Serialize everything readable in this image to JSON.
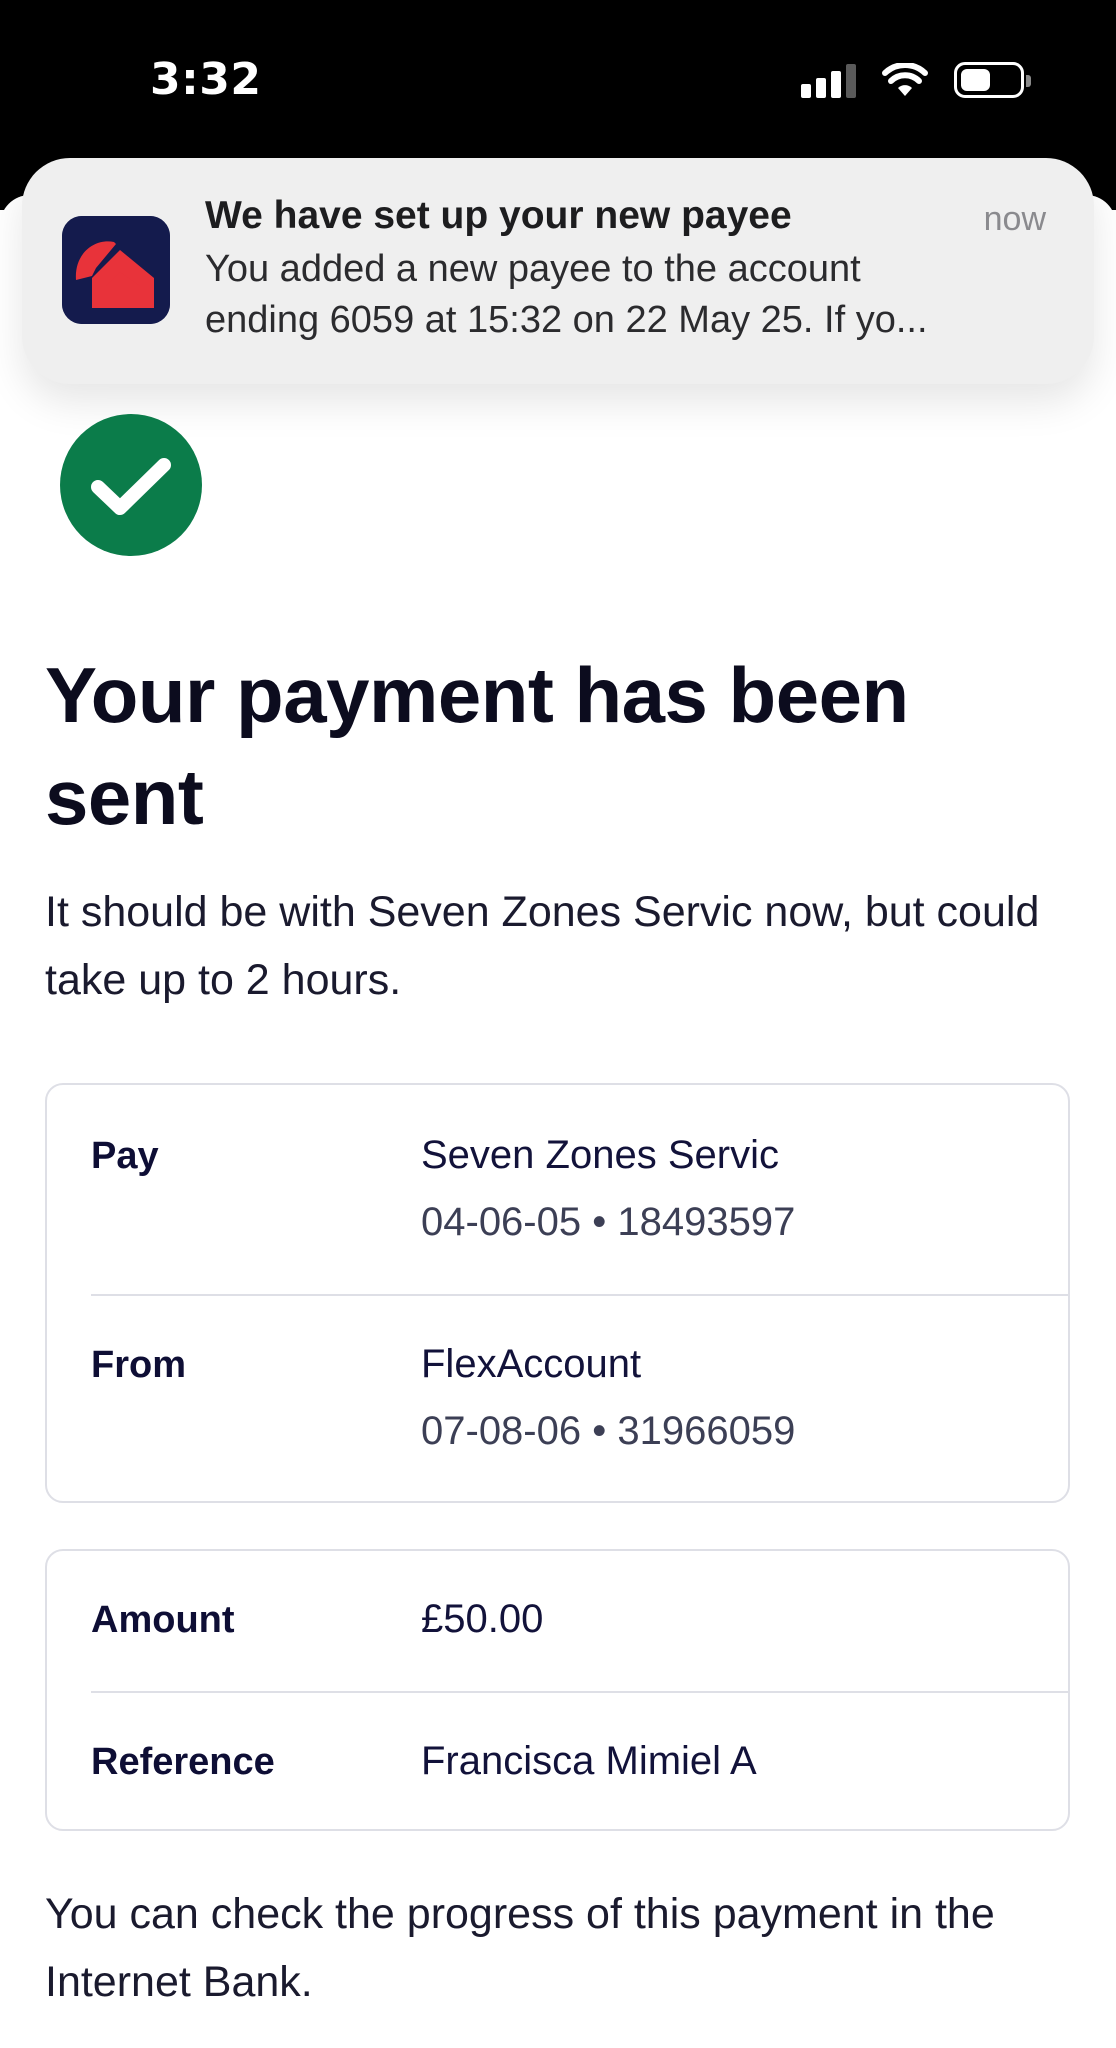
{
  "status_bar": {
    "time": "3:32",
    "signal_bars": 3,
    "signal_bars_total": 4,
    "battery_level": 0.45
  },
  "notification": {
    "title": "We have set up your new payee",
    "time": "now",
    "body_line_1": "You added a new payee to the account",
    "body_line_2": "ending 6059 at 15:32 on 22 May 25. If yo...",
    "icon": "bank-app-icon",
    "icon_colors": {
      "background": "#141b4d",
      "accent": "#e8333a"
    }
  },
  "success": {
    "icon": "checkmark-icon",
    "color": "#0b7c4a"
  },
  "title": "Your payment has been sent",
  "intro": "It should be with Seven Zones Servic now, but could take up to 2 hours.",
  "payment_details": {
    "pay": {
      "label": "Pay",
      "name": "Seven Zones Servic",
      "account": "04-06-05 • 18493597"
    },
    "from": {
      "label": "From",
      "name": "FlexAccount",
      "account": "07-08-06 • 31966059"
    }
  },
  "amount_details": {
    "amount": {
      "label": "Amount",
      "value": "£50.00"
    },
    "reference": {
      "label": "Reference",
      "value": "Francisca Mimiel A"
    }
  },
  "footer": "You can check the progress of this payment in the Internet Bank."
}
